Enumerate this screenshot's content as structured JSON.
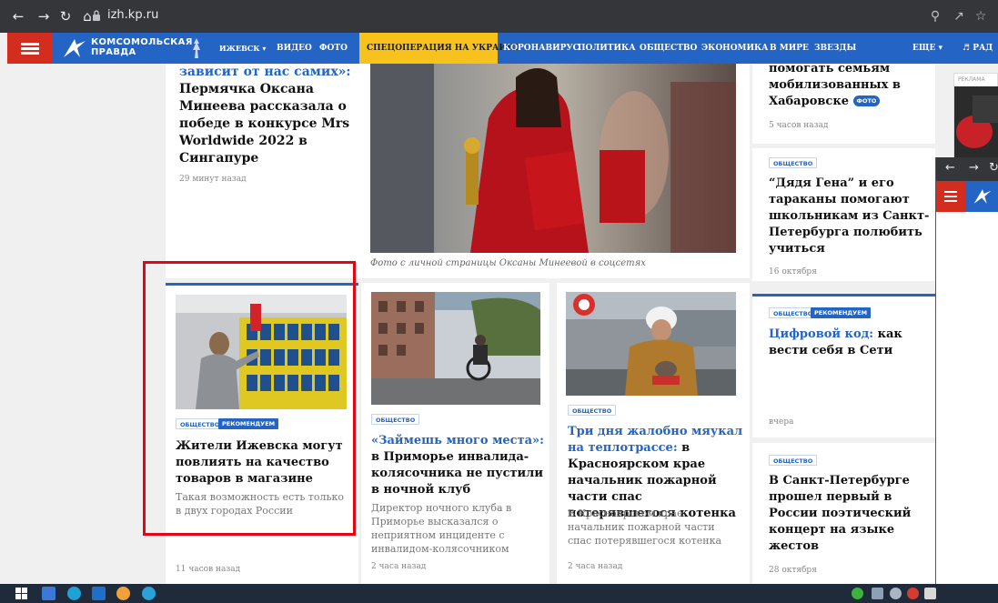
{
  "browser": {
    "url": "izh.kp.ru",
    "back_icon": "arrow-left-icon",
    "forward_icon": "arrow-right-icon",
    "reload_icon": "reload-icon",
    "home_icon": "home-icon"
  },
  "site": {
    "logo_line1": "КОМСОМОЛЬСКАЯ",
    "logo_line2": "ПРАВДА",
    "city": "ИЖЕВСК",
    "menu": [
      "ВИДЕО",
      "ФОТО",
      "СПЕЦОПЕРАЦИЯ НА УКРАИНЕ",
      "КОРОНАВИРУС",
      "ПОЛИТИКА",
      "ОБЩЕСТВО",
      "ЭКОНОМИКА",
      "В МИРЕ",
      "ЗВЕЗДЫ"
    ],
    "more": "ЕЩЕ",
    "radio": "РАД",
    "colors": {
      "header": "#2464c4",
      "accent": "#f7c21b",
      "burger": "#d22d1e",
      "highlight": "#e30613"
    }
  },
  "featured": {
    "title_hl": "зависит от нас самих»:",
    "title": "Пермячка Оксана Минеева рассказала о победе в конкурсе Mrs Worldwide 2022 в Сингапуре",
    "time": "29 минут назад",
    "caption": "Фото с личной страницы Оксаны Минеевой в соцсетях"
  },
  "right_top": {
    "title": "помогать семьям мобилизованных в Хабаровске",
    "badge": "ФОТО",
    "time": "5 часов назад"
  },
  "right_mid": {
    "tag": "ОБЩЕСТВО",
    "title": "“Дядя Гена” и его тараканы помогают школьникам из Санкт-Петербурга полюбить учиться",
    "time": "16 октября"
  },
  "right_cyber": {
    "tag1": "ОБЩЕСТВО",
    "tag2": "РЕКОМЕНДУЕМ",
    "title_hl": "Цифровой код:",
    "title": " как вести себя в Сети",
    "time": "вчера"
  },
  "right_bottom": {
    "tag": "ОБЩЕСТВО",
    "title": "В Санкт-Петербурге прошел первый в России поэтический концерт на языке жестов",
    "time": "28 октября"
  },
  "card_store": {
    "tag1": "ОБЩЕСТВО",
    "tag2": "РЕКОМЕНДУЕМ",
    "title": "Жители Ижевска могут повлиять на качество товаров в магазине",
    "sub": "Такая возможность есть только в двух городах России",
    "time": "11 часов назад"
  },
  "card_club": {
    "tag": "ОБЩЕСТВО",
    "title_hl": "«Займешь много места»:",
    "title": " в Приморье инвалида-колясочника не пустили в ночной клуб",
    "sub": "Директор ночного клуба в Приморье высказался о неприятном инциденте с инвалидом-колясочником",
    "time": "2 часа назад"
  },
  "card_kitten": {
    "tag": "ОБЩЕСТВО",
    "title_hl": "Три дня жалобно мяукал на теплотрассе:",
    "title": " в Красноярском крае начальник пожарной части спас потерявшегося котенка",
    "sub": "В Красноярском крае начальник пожарной части спас потерявшегося котенка",
    "time": "2 часа назад"
  },
  "ad": {
    "label": "РЕКЛАМА"
  }
}
